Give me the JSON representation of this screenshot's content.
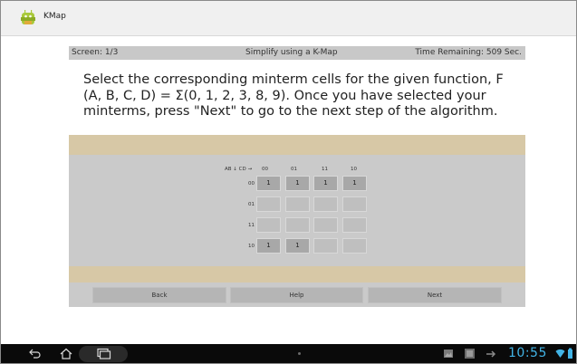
{
  "app": {
    "title": "KMap",
    "icon": "android-robot-icon"
  },
  "info_strip": {
    "screen": "Screen: 1/3",
    "center": "Simplify using a K-Map",
    "time": "Time Remaining: 509 Sec."
  },
  "instructions": "Select the corresponding minterm cells for the given function, F (A, B, C, D)  = Σ(0, 1, 2, 3, 8, 9). Once you have selected your minterms, press \"Next\" to go to the next step of the algorithm.",
  "kmap": {
    "header": "AB ↓ CD →",
    "columns": [
      "00",
      "01",
      "11",
      "10"
    ],
    "rows": [
      {
        "label": "00",
        "cells": [
          "1",
          "1",
          "1",
          "1"
        ]
      },
      {
        "label": "01",
        "cells": [
          "",
          "",
          "",
          ""
        ]
      },
      {
        "label": "11",
        "cells": [
          "",
          "",
          "",
          ""
        ]
      },
      {
        "label": "10",
        "cells": [
          "1",
          "1",
          "",
          ""
        ]
      }
    ]
  },
  "buttons": {
    "back": "Back",
    "help": "Help",
    "next": "Next"
  },
  "system_bar": {
    "clock": "10:55",
    "icons": [
      "back-nav-icon",
      "home-nav-icon",
      "recent-apps-icon",
      "gallery-icon",
      "image-icon",
      "usb-icon",
      "wifi-icon",
      "battery-icon"
    ],
    "clock_color": "#42b4e6"
  },
  "colors": {
    "band": "#d7c8a6",
    "panel": "#cacaca",
    "info_strip": "#c8c8c8"
  }
}
